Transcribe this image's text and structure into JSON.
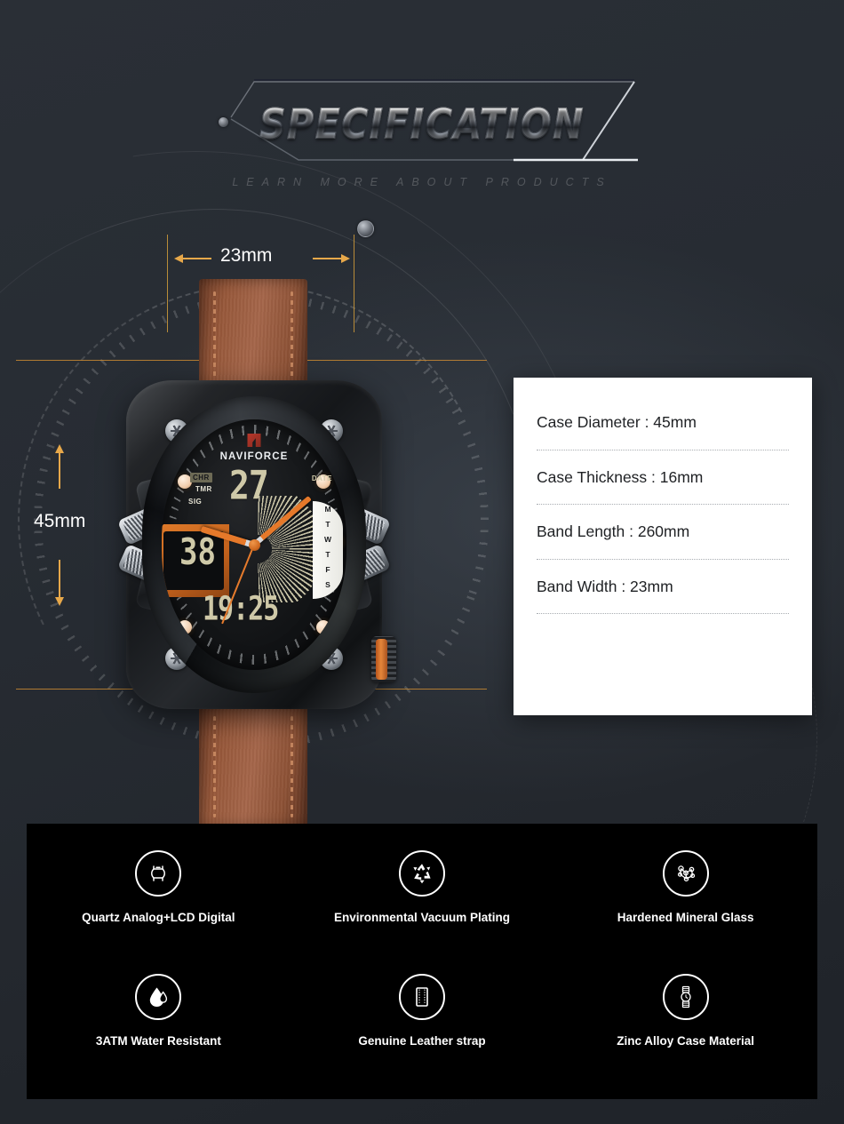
{
  "header": {
    "title": "SPECIFICATION",
    "subtitle": "LEARN MORE ABOUT PRODUCTS"
  },
  "dimensions": {
    "band_width_label": "23mm",
    "case_diameter_label": "45mm",
    "guide_color": "#c98a33"
  },
  "watch": {
    "brand": "NAVIFORCE",
    "lcd_date": "27",
    "lcd_sub": "38",
    "lcd_time": "19:25",
    "label_chr": "CHR",
    "label_date": "DATE",
    "label_tmr": "TMR",
    "label_sig": "SIG",
    "day_scale": [
      "M",
      "T",
      "W",
      "T",
      "F",
      "S"
    ],
    "strap_color": "#8f5135",
    "accent_color": "#e6792a",
    "case_color": "#15171a"
  },
  "specs": [
    {
      "text": "Case Diameter : 45mm"
    },
    {
      "text": "Case Thickness : 16mm"
    },
    {
      "text": "Band Length : 260mm"
    },
    {
      "text": "Band Width : 23mm"
    }
  ],
  "features": [
    {
      "icon": "watch-case-icon",
      "label": "Quartz Analog+LCD Digital"
    },
    {
      "icon": "recycle-icon",
      "label": "Environmental Vacuum Plating"
    },
    {
      "icon": "molecule-icon",
      "label": "Hardened Mineral Glass"
    },
    {
      "icon": "water-drop-icon",
      "label": "3ATM Water Resistant"
    },
    {
      "icon": "leather-strap-icon",
      "label": "Genuine Leather strap"
    },
    {
      "icon": "wristwatch-icon",
      "label": "Zinc Alloy Case Material"
    }
  ]
}
